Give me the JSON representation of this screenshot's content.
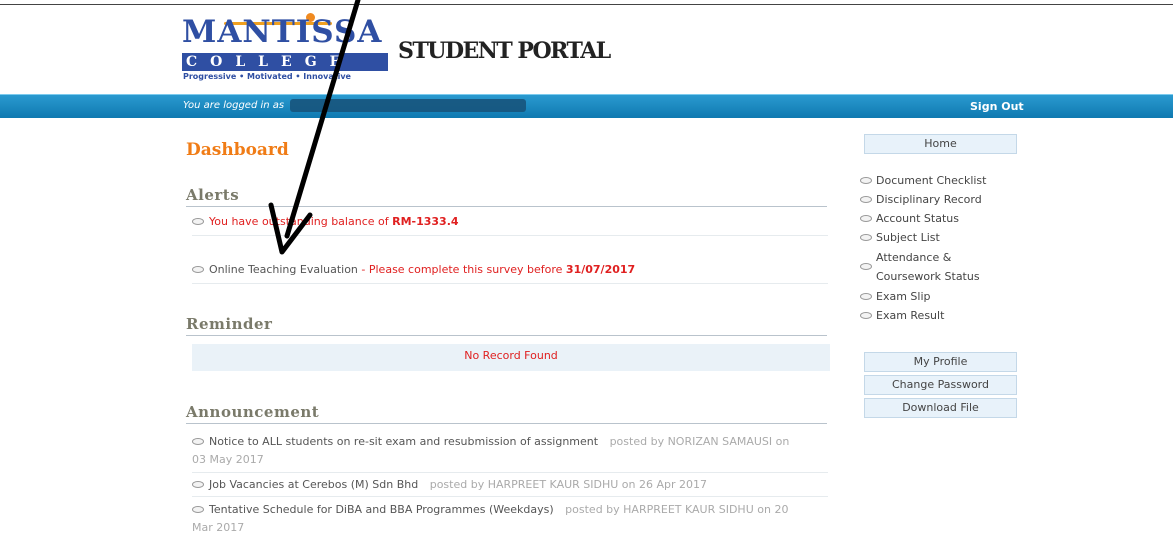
{
  "logo": {
    "name": "MANTISSA",
    "college": "COLLEGE",
    "tagline": "Progressive • Motivated • Innovative"
  },
  "portal_title": "STUDENT PORTAL",
  "topbar": {
    "logged_in_label": "You are logged in as",
    "sign_out": "Sign Out"
  },
  "dashboard": {
    "title": "Dashboard",
    "alerts": {
      "heading": "Alerts",
      "balance_text": "You have outstanding balance of ",
      "balance_value": "RM-1333.4",
      "evaluation_link": "Online Teaching Evaluation",
      "evaluation_text": " - Please complete this survey before ",
      "evaluation_date": "31/07/2017"
    },
    "reminder": {
      "heading": "Reminder",
      "empty": "No Record Found"
    },
    "announcement": {
      "heading": "Announcement",
      "items": [
        {
          "title": "Notice to ALL students on re-sit exam and resubmission of assignment",
          "meta_line1": "posted by NORIZAN SAMAUSI on",
          "meta_line2": "03 May 2017"
        },
        {
          "title": "Job Vacancies at Cerebos (M) Sdn Bhd",
          "meta_line1": "posted by HARPREET KAUR SIDHU on 26 Apr 2017"
        },
        {
          "title": "Tentative Schedule for DiBA and BBA Programmes (Weekdays)",
          "meta_line1": "posted by HARPREET KAUR SIDHU on 20",
          "meta_line2": "Mar 2017"
        }
      ]
    }
  },
  "sidebar": {
    "home": "Home",
    "links": [
      "Document Checklist",
      "Disciplinary Record",
      "Account Status",
      "Subject List",
      "Attendance & Coursework Status",
      "Exam Slip",
      "Exam Result"
    ],
    "my_profile": "My Profile",
    "change_password": "Change Password",
    "download_file": "Download File"
  },
  "colors": {
    "brand_blue": "#2f4fa3",
    "bar_blue": "#1684bd",
    "dashboard_orange": "#f07c16",
    "alert_red": "#e02020"
  }
}
